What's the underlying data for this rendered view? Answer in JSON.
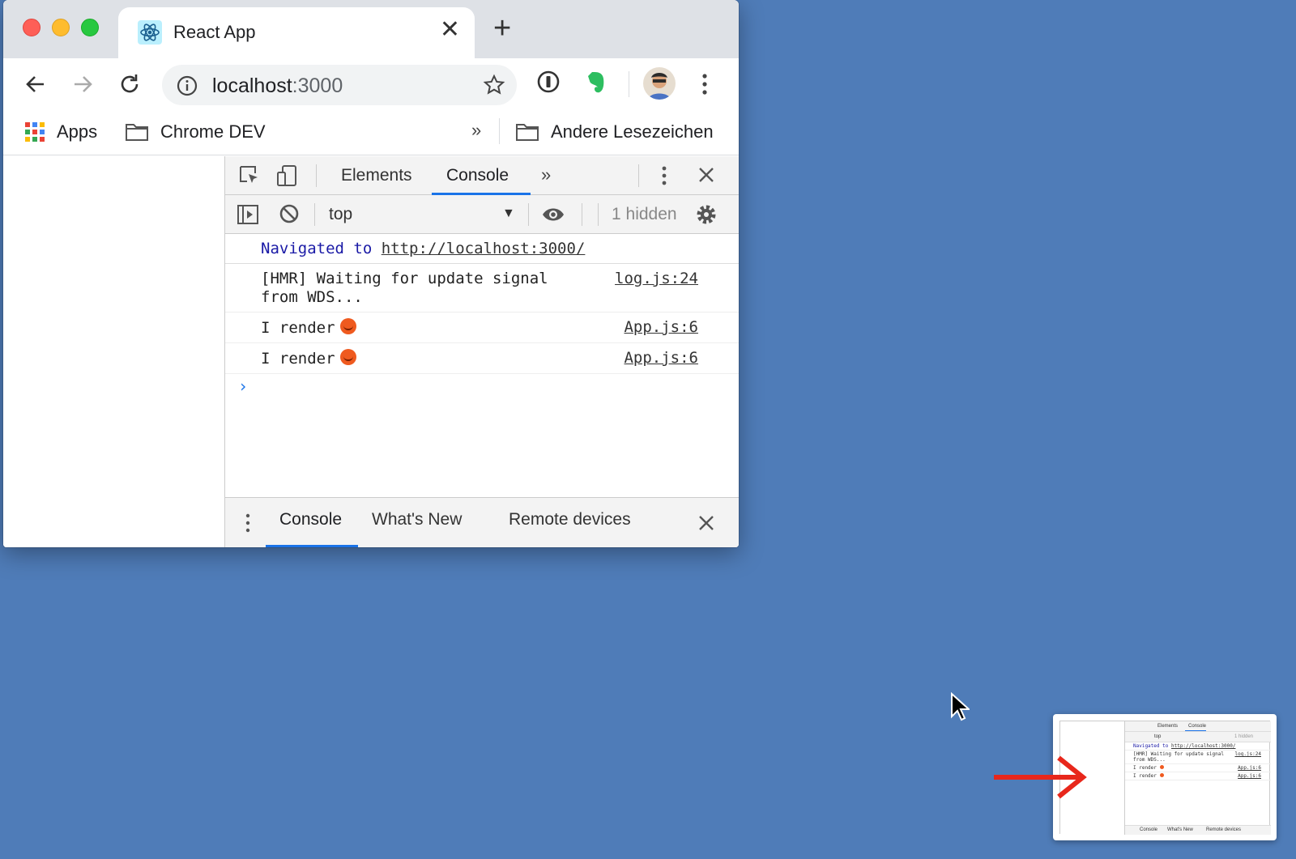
{
  "browser": {
    "tab_title": "React App",
    "url_host": "localhost",
    "url_port": ":3000"
  },
  "bookmarks": {
    "apps": "Apps",
    "chrome_dev": "Chrome DEV",
    "more": "»",
    "other": "Andere Lesezeichen"
  },
  "devtools": {
    "tabs": [
      "Elements",
      "Console"
    ],
    "more": "»",
    "context": "top",
    "hidden": "1 hidden",
    "messages": [
      {
        "type": "nav",
        "prefix": "Navigated to ",
        "link": "http://localhost:3000/"
      },
      {
        "text_line1": "[HMR] Waiting for update signal",
        "text_line2": "from WDS...",
        "source": "log.js:24"
      },
      {
        "text": "I render",
        "source": "App.js:6"
      },
      {
        "text": "I render",
        "source": "App.js:6"
      }
    ],
    "prompt": "›",
    "drawer_tabs": [
      "Console",
      "What's New",
      "Remote devices"
    ]
  },
  "thumbnail": {
    "tabs": [
      "Elements",
      "Console"
    ],
    "context": "top",
    "hidden": "1 hidden",
    "nav": "Navigated to",
    "nav_link": "http://localhost:3000/",
    "line1": "[HMR] Waiting for update signal",
    "line2": "from WDS...",
    "line1_src": "log.js:24",
    "render": "I render",
    "render_src": "App.js:6",
    "drawer_tabs": [
      "Console",
      "What's New",
      "Remote devices"
    ]
  },
  "colors": {
    "desktop": "#4f7cb8",
    "accent": "#1a73e8",
    "arrow": "#e8271b"
  }
}
